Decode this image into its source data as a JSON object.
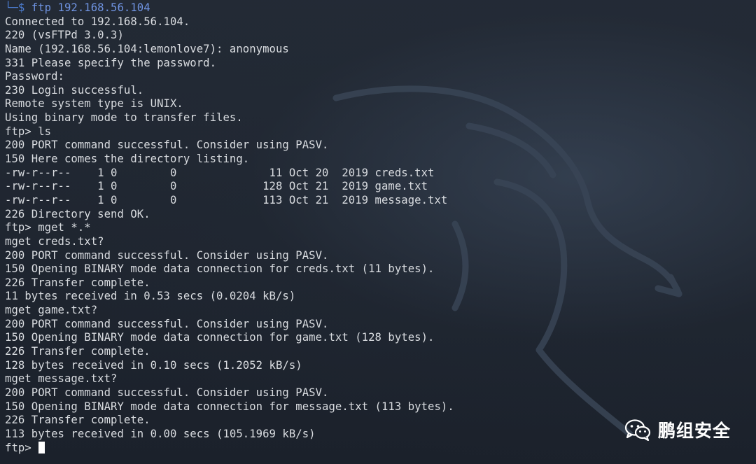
{
  "prompt": {
    "symbol": "└─$",
    "command": "ftp 192.168.56.104"
  },
  "output_lines": [
    "Connected to 192.168.56.104.",
    "220 (vsFTPd 3.0.3)",
    "Name (192.168.56.104:lemonlove7): anonymous",
    "331 Please specify the password.",
    "Password:",
    "230 Login successful.",
    "Remote system type is UNIX.",
    "Using binary mode to transfer files.",
    "ftp> ls",
    "200 PORT command successful. Consider using PASV.",
    "150 Here comes the directory listing.",
    "-rw-r--r--    1 0        0              11 Oct 20  2019 creds.txt",
    "-rw-r--r--    1 0        0             128 Oct 21  2019 game.txt",
    "-rw-r--r--    1 0        0             113 Oct 21  2019 message.txt",
    "226 Directory send OK.",
    "ftp> mget *.*",
    "mget creds.txt?",
    "200 PORT command successful. Consider using PASV.",
    "150 Opening BINARY mode data connection for creds.txt (11 bytes).",
    "226 Transfer complete.",
    "11 bytes received in 0.53 secs (0.0204 kB/s)",
    "mget game.txt?",
    "200 PORT command successful. Consider using PASV.",
    "150 Opening BINARY mode data connection for game.txt (128 bytes).",
    "226 Transfer complete.",
    "128 bytes received in 0.10 secs (1.2052 kB/s)",
    "mget message.txt?",
    "200 PORT command successful. Consider using PASV.",
    "150 Opening BINARY mode data connection for message.txt (113 bytes).",
    "226 Transfer complete.",
    "113 bytes received in 0.00 secs (105.1969 kB/s)"
  ],
  "input_prompt": "ftp> ",
  "watermark": {
    "icon": "wechat-icon",
    "text": "鹏组安全"
  },
  "colors": {
    "background": "#1f2530",
    "text": "#d9dce0",
    "prompt": "#4d7fd4"
  }
}
